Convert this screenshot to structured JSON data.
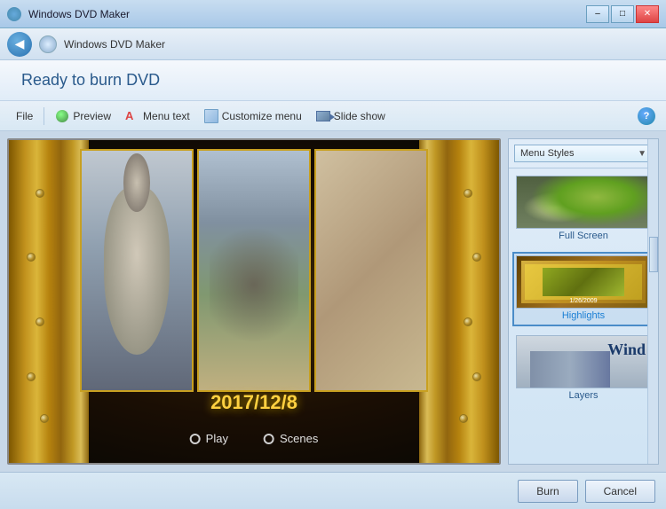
{
  "titlebar": {
    "title": "Windows DVD Maker",
    "minimize_label": "–",
    "maximize_label": "□",
    "close_label": "✕"
  },
  "nav": {
    "title_input": "",
    "title_placeholder": "Windows DVD Maker"
  },
  "header": {
    "title": "Ready to burn DVD"
  },
  "toolbar": {
    "file_label": "File",
    "preview_label": "Preview",
    "menu_text_label": "Menu text",
    "customize_menu_label": "Customize menu",
    "slide_show_label": "Slide show",
    "help_label": "?"
  },
  "preview": {
    "date_text": "2017/12/8",
    "play_label": "Play",
    "scenes_label": "Scenes"
  },
  "styles_panel": {
    "dropdown_label": "Menu Styles",
    "items": [
      {
        "id": "fullscreen",
        "label": "Full Screen",
        "selected": false
      },
      {
        "id": "highlights",
        "label": "Highlights",
        "selected": true
      },
      {
        "id": "layers",
        "label": "Layers",
        "selected": false
      }
    ]
  },
  "footer": {
    "burn_label": "Burn",
    "cancel_label": "Cancel"
  }
}
